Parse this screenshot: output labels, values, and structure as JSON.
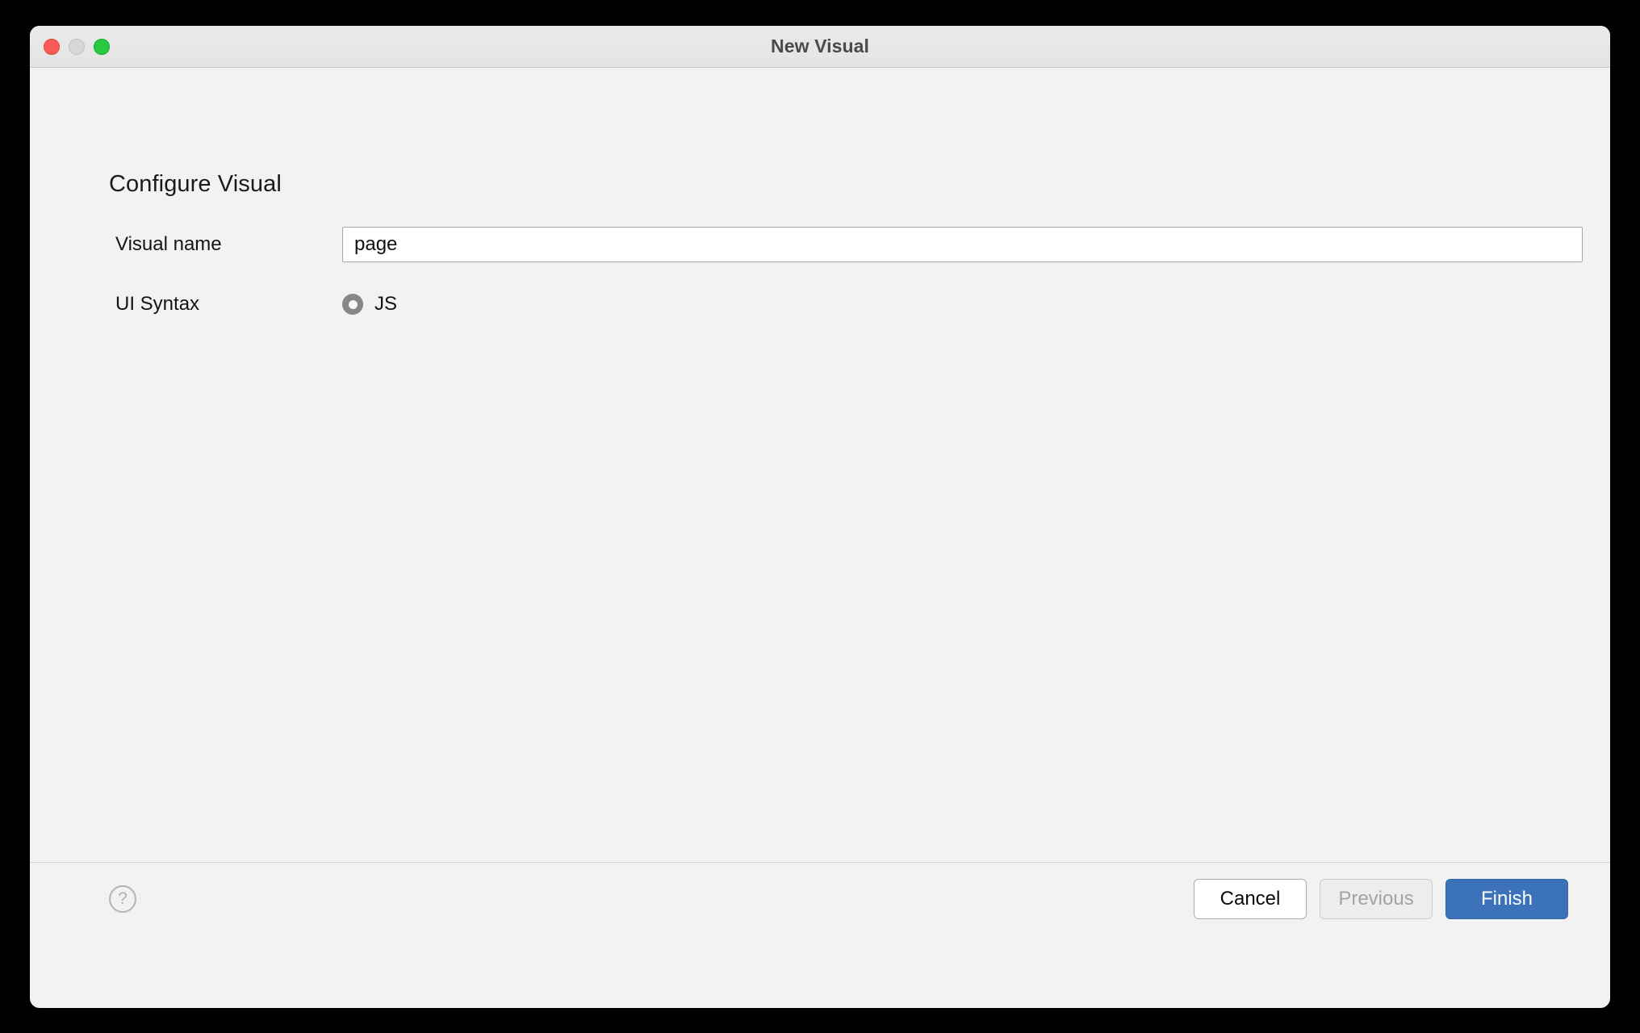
{
  "window": {
    "title": "New Visual",
    "traffic_lights": [
      {
        "name": "close",
        "color": "#fc5b57"
      },
      {
        "name": "minimize",
        "color": "#d7d7d7"
      },
      {
        "name": "zoom",
        "color": "#28c840"
      }
    ]
  },
  "page": {
    "heading": "Configure Visual"
  },
  "form": {
    "visual_name": {
      "label": "Visual name",
      "value": "page",
      "placeholder": ""
    },
    "ui_syntax": {
      "label": "UI Syntax",
      "options": [
        {
          "label": "JS",
          "selected": true
        }
      ]
    }
  },
  "footer": {
    "help_icon": "?",
    "buttons": {
      "cancel": "Cancel",
      "previous": "Previous",
      "finish": "Finish"
    }
  },
  "colors": {
    "primary": "#3b72b9",
    "window_bg": "#f2f2f2",
    "titlebar_bg": "#e6e6e6",
    "radio_fill": "#878787"
  }
}
